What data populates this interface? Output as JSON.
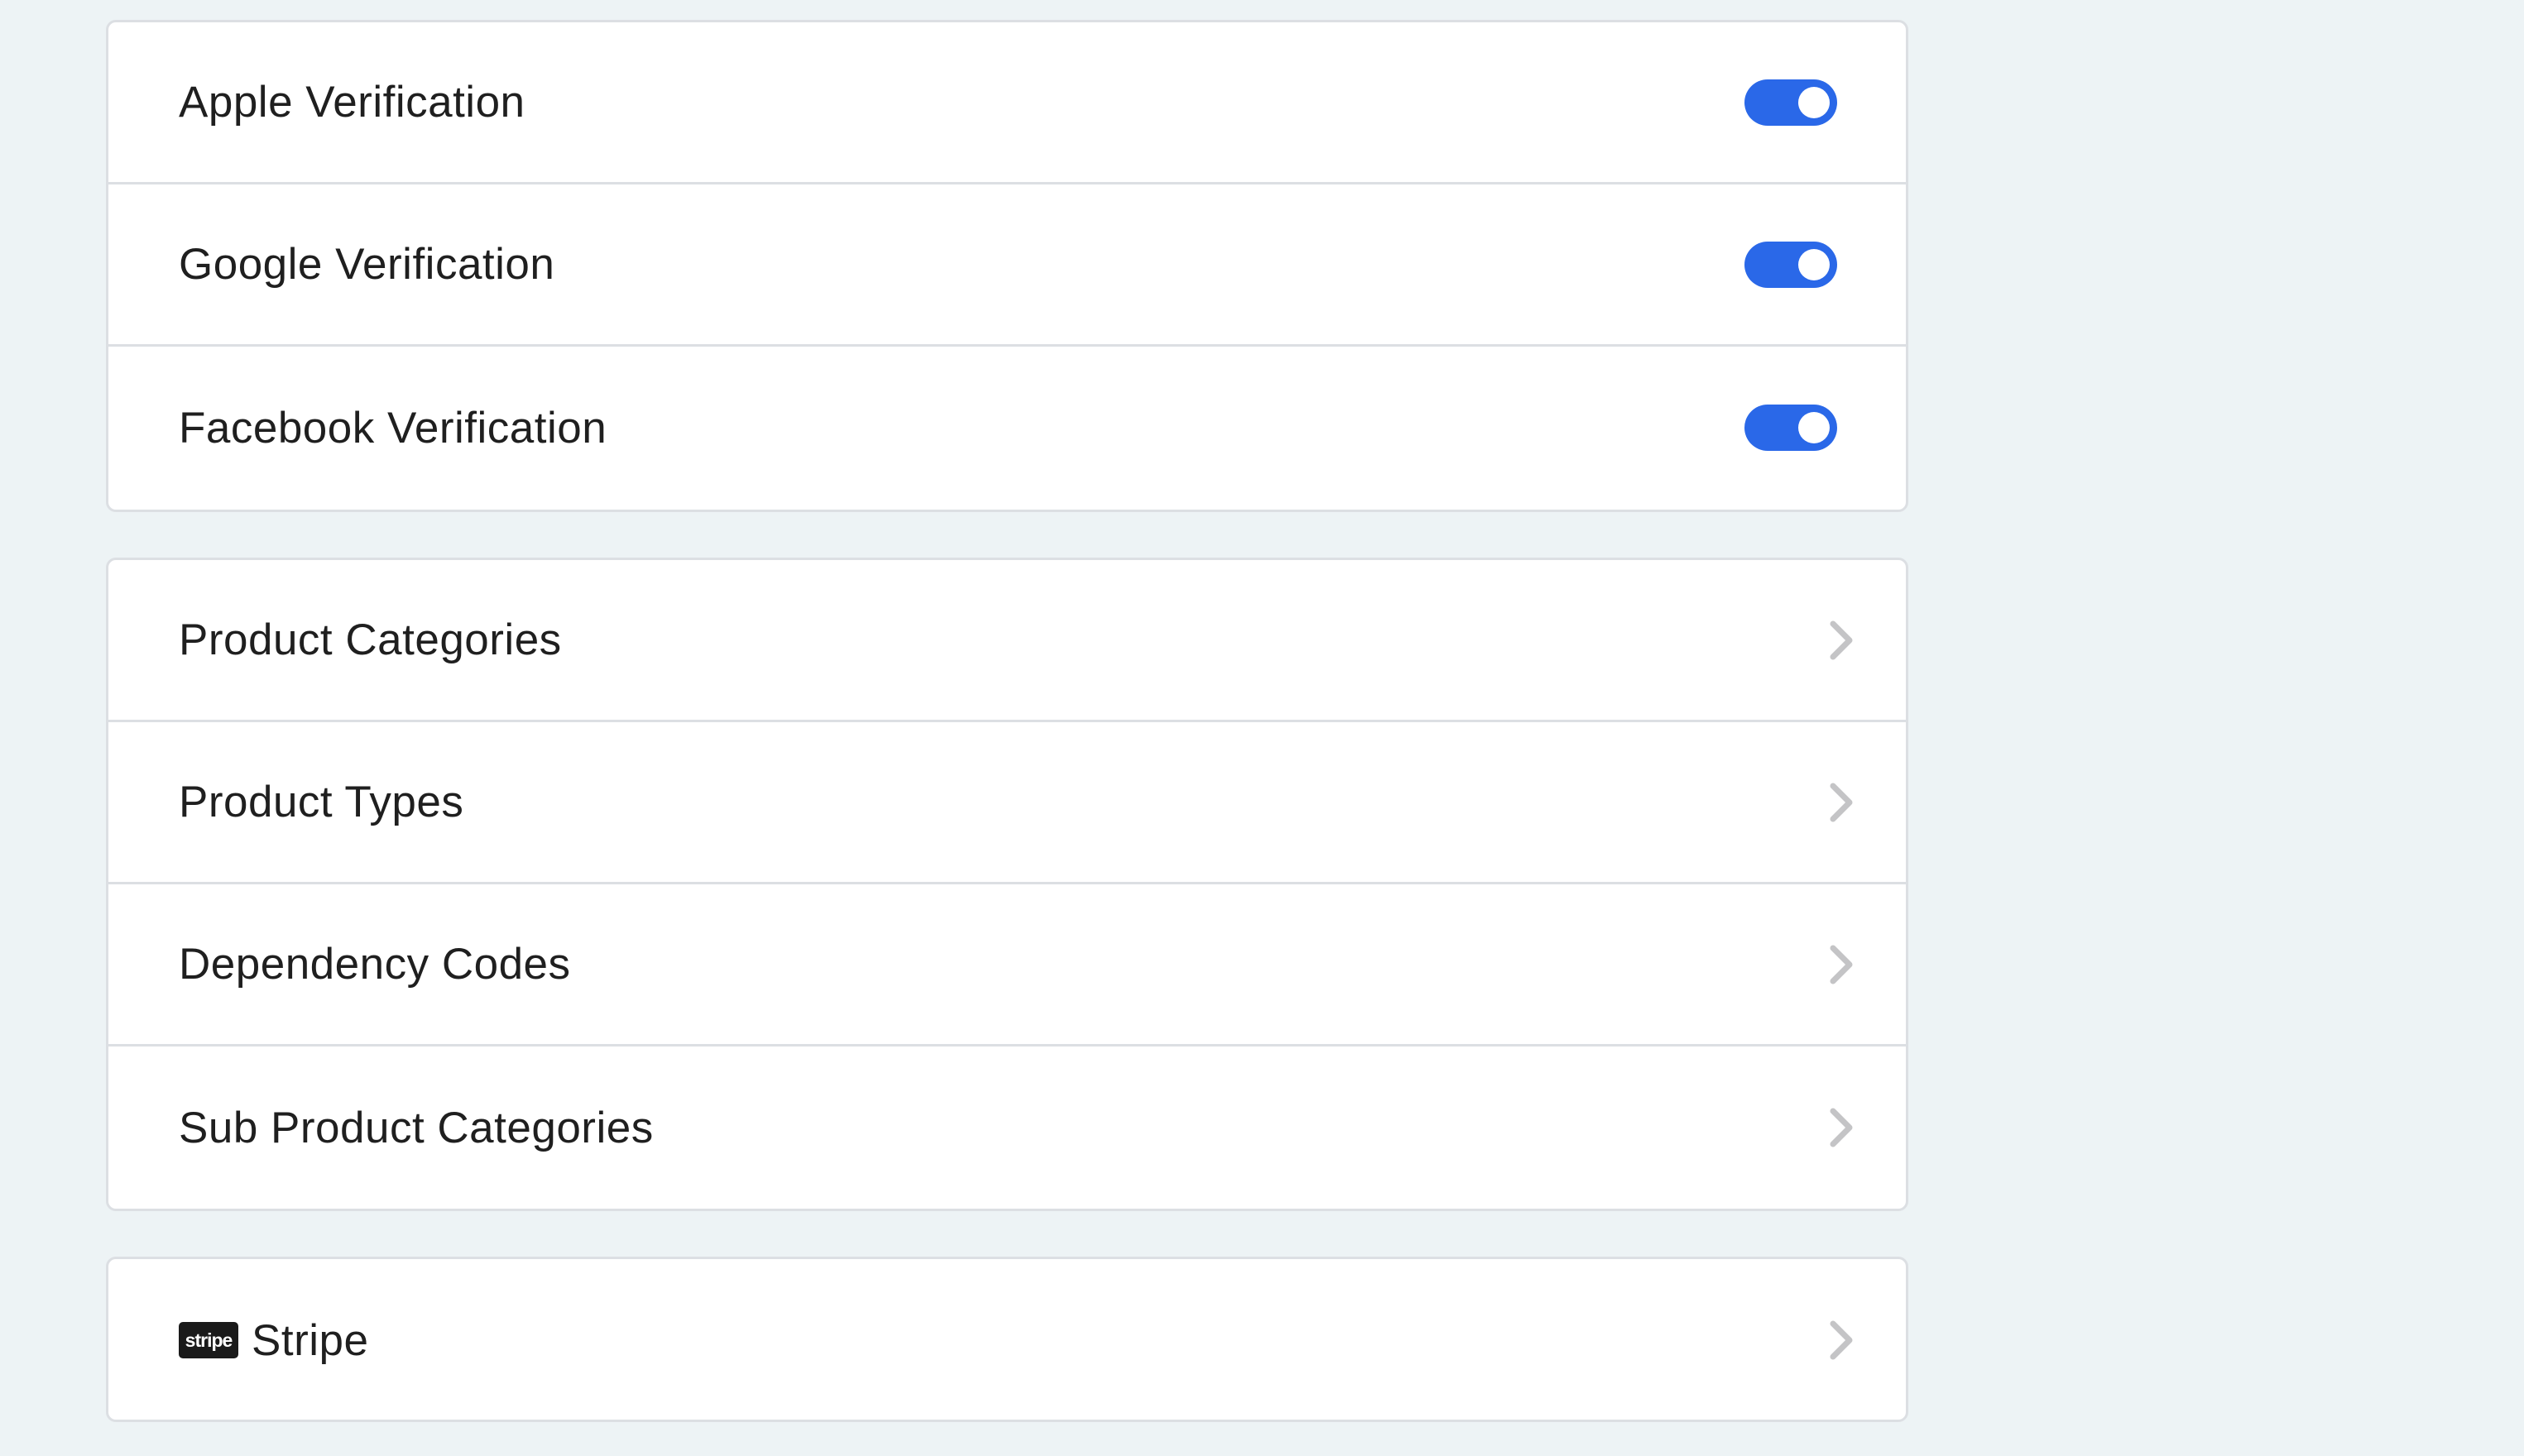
{
  "verification": {
    "items": [
      {
        "label": "Apple Verification",
        "enabled": true
      },
      {
        "label": "Google Verification",
        "enabled": true
      },
      {
        "label": "Facebook Verification",
        "enabled": true
      }
    ]
  },
  "products": {
    "items": [
      {
        "label": "Product Categories",
        "icon": "chevron-right-icon"
      },
      {
        "label": "Product Types",
        "icon": "chevron-right-icon"
      },
      {
        "label": "Dependency Codes",
        "icon": "chevron-right-icon"
      },
      {
        "label": "Sub Product Categories",
        "icon": "chevron-right-icon"
      }
    ]
  },
  "payments": {
    "items": [
      {
        "label": "Stripe",
        "logo_text": "stripe",
        "icon": "chevron-right-icon"
      }
    ]
  },
  "colors": {
    "background": "#edf3f5",
    "card": "#ffffff",
    "border": "#dcdfe3",
    "toggle_on": "#2a68e8",
    "chevron": "#c4c4c6",
    "text": "#1f1f1f"
  }
}
